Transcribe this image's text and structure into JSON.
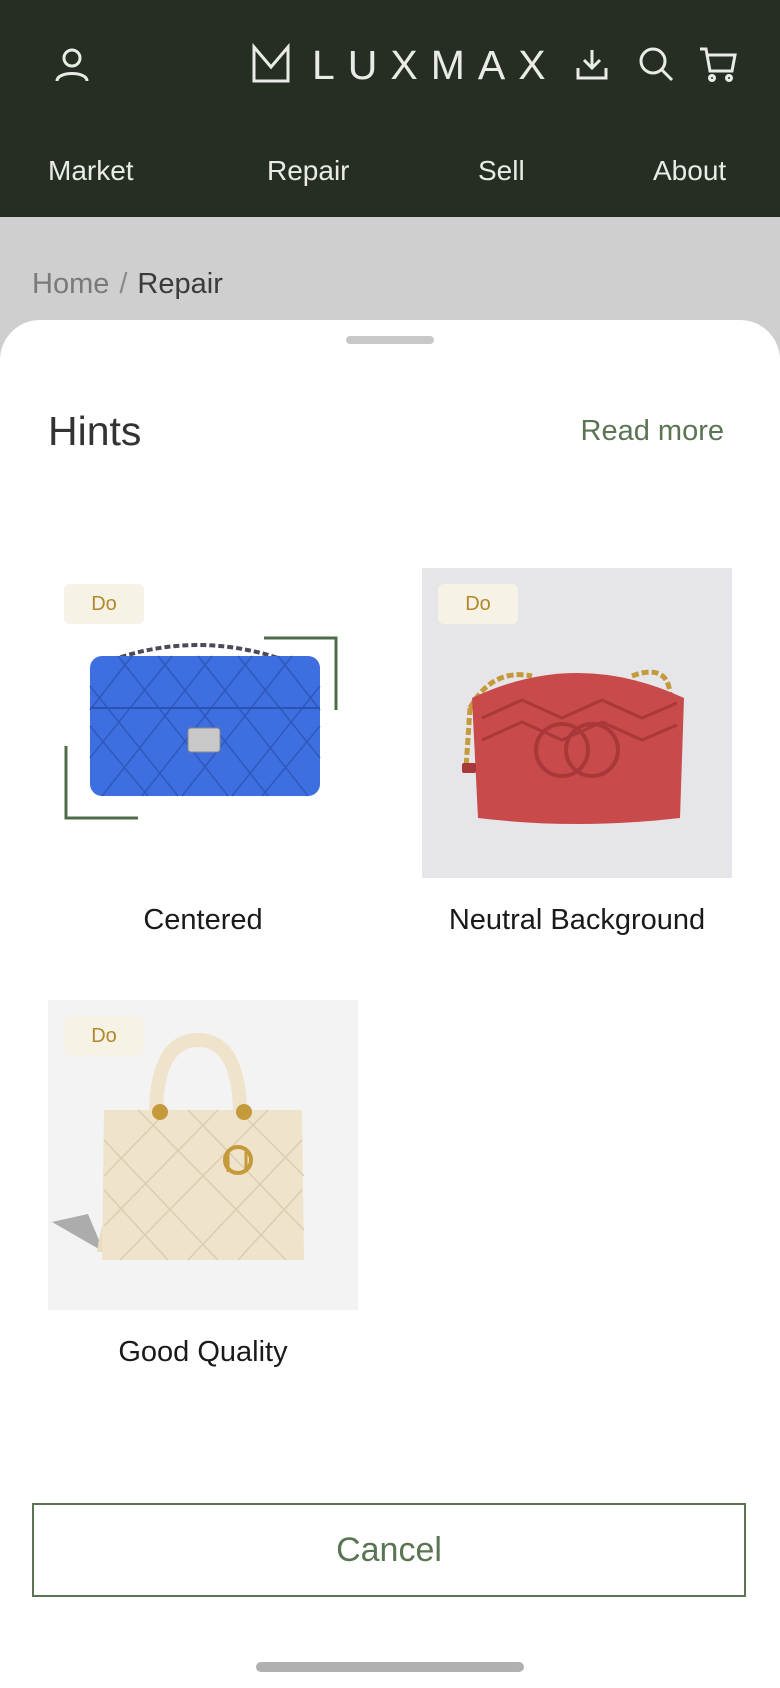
{
  "app": {
    "brand": "LUXMAX",
    "icons": [
      "user-icon",
      "logo-icon",
      "download-icon",
      "search-icon",
      "cart-icon"
    ]
  },
  "nav": [
    {
      "label": "Market"
    },
    {
      "label": "Repair"
    },
    {
      "label": "Sell"
    },
    {
      "label": "About"
    }
  ],
  "breadcrumb": {
    "home": "Home",
    "separator": "/",
    "current": "Repair"
  },
  "sheet": {
    "title": "Hints",
    "read_more": "Read more",
    "cards": [
      {
        "badge": "Do",
        "caption": "Centered",
        "image": "blue-quilted-chanel-bag"
      },
      {
        "badge": "Do",
        "caption": "Neutral Background",
        "image": "red-gucci-marmont-bag"
      },
      {
        "badge": "Do",
        "caption": "Good Quality",
        "image": "cream-dior-bag"
      }
    ],
    "cancel": "Cancel"
  },
  "colors": {
    "header_bg": "#262e24",
    "accent": "#5b7454",
    "badge_text": "#b08a2a",
    "badge_bg": "#f6f2e6"
  }
}
